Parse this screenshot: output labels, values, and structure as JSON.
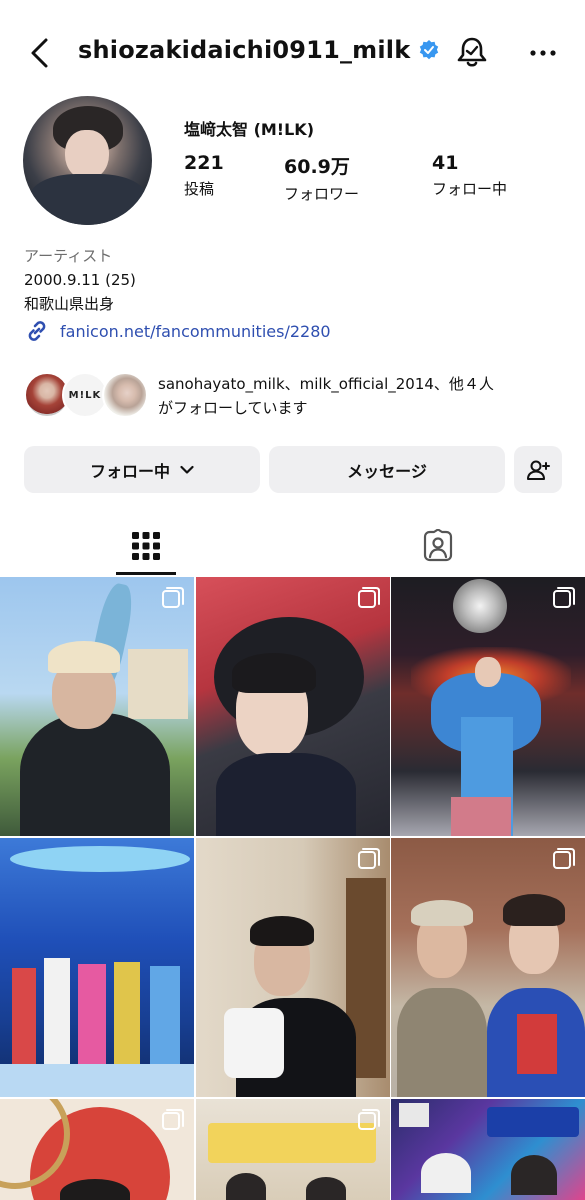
{
  "header": {
    "username": "shiozakidaichi0911_milk",
    "verified_color": "#3897f0",
    "icons": [
      "back-arrow-icon",
      "verified-badge-icon",
      "bell-icon",
      "more-icon"
    ]
  },
  "profile": {
    "display_name": "塩﨑太智 (M!LK)",
    "stats": [
      {
        "value": "221",
        "label": "投稿"
      },
      {
        "value": "60.9万",
        "label": "フォロワー"
      },
      {
        "value": "41",
        "label": "フォロー中"
      }
    ],
    "bio": {
      "category": "アーティスト",
      "line1": "2000.9.11 (25)",
      "line2": "和歌山県出身"
    },
    "link": "fanicon.net/fancommunities/2280",
    "link_color": "#2f4fb0"
  },
  "followed_by": {
    "line1": "sanohayato_milk、milk_official_2014、他４人",
    "line2": "がフォローしています",
    "logo_text": "M!LK"
  },
  "actions": {
    "follow_label": "フォロー中",
    "message_label": "メッセージ"
  },
  "tabs": {
    "active": "grid"
  }
}
